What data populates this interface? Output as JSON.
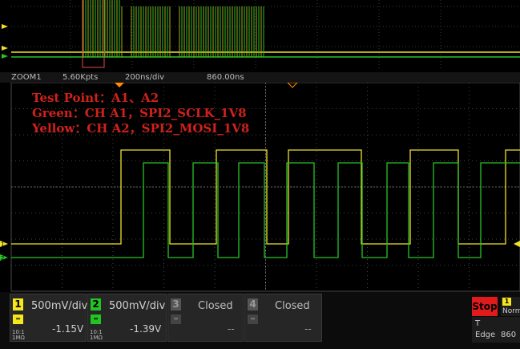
{
  "overlay": {
    "line1": "Test Point：A1、A2",
    "line2": "Green：CH A1，SPI2_SCLK_1V8",
    "line3": "Yellow：CH A2，SPI2_MOSI_1V8",
    "colors": {
      "yellow_text": "#d0211b",
      "green_text": "#d0211b"
    }
  },
  "zoom_bar": {
    "label": "ZOOM1",
    "points": "5.60Kpts",
    "timebase": "200ns/div",
    "delay": "860.00ns"
  },
  "channels": [
    {
      "num": "1",
      "scale": "500mV/div",
      "offset": "-1.15V",
      "impedance_top": "10:1",
      "impedance_bottom": "1MΩ",
      "color": "#f5e61e"
    },
    {
      "num": "2",
      "scale": "500mV/div",
      "offset": "-1.39V",
      "impedance_top": "10:1",
      "impedance_bottom": "1MΩ",
      "color": "#22c322"
    },
    {
      "num": "3",
      "state": "Closed",
      "offset": "--"
    },
    {
      "num": "4",
      "state": "Closed",
      "offset": "--"
    }
  ],
  "run_state": "Stop",
  "trigger": {
    "source_num": "1",
    "mode": "Norm",
    "type_label": "T",
    "edge_label": "Edge",
    "level": "860"
  },
  "colors": {
    "yellow_trace": "#f0e22a",
    "green_trace": "#27c427",
    "grid": "#4a4a4a",
    "marker_orange": "#ff8c00"
  }
}
